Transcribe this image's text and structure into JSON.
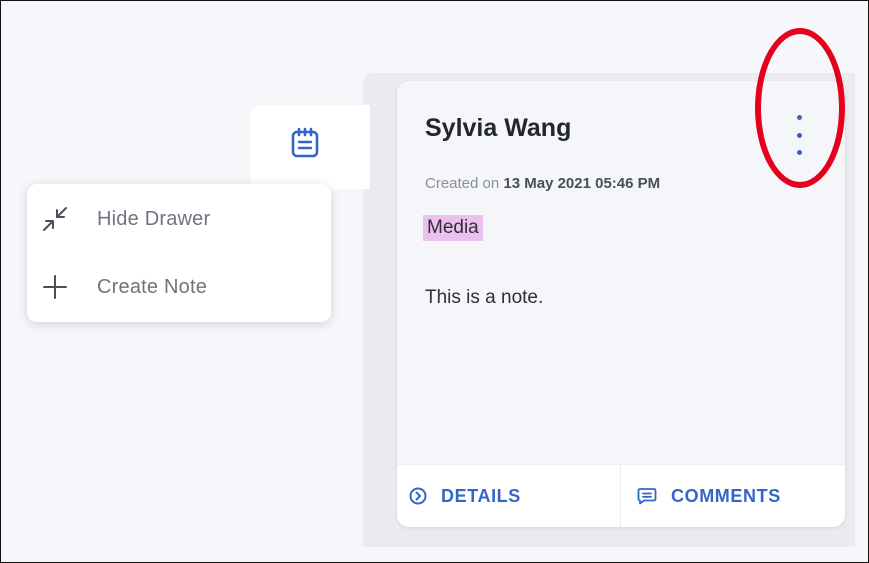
{
  "menu": {
    "items": [
      {
        "label": "Hide Drawer",
        "icon": "collapse-arrows-icon"
      },
      {
        "label": "Create Note",
        "icon": "plus-icon"
      }
    ]
  },
  "tab": {
    "icon": "notepad-icon"
  },
  "note": {
    "author": "Sylvia Wang",
    "created_prefix": "Created on",
    "created_date": "13 May 2021 05:46 PM",
    "tag": "Media",
    "body": "This is a note.",
    "more_icon": "kebab-menu-icon"
  },
  "footer": {
    "details_label": "DETAILS",
    "comments_label": "COMMENTS"
  },
  "colors": {
    "accent": "#3566c6",
    "tag_bg": "#ecc0ee",
    "annotation": "#e6001c"
  }
}
